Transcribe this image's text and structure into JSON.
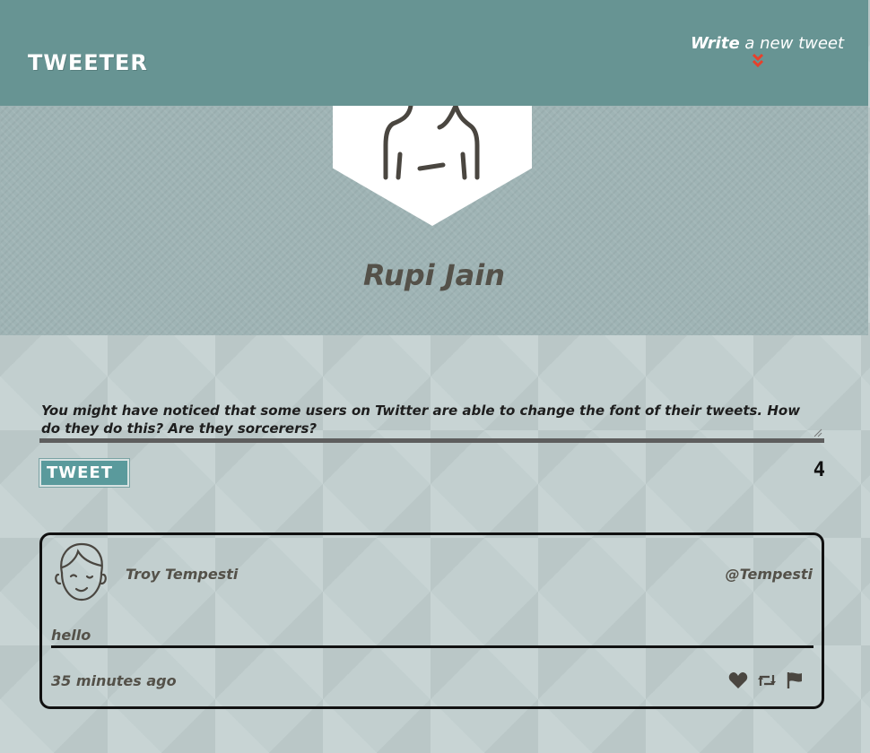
{
  "nav": {
    "brand": "TWEETER",
    "compose_strong": "Write",
    "compose_rest": " a new tweet",
    "chevron_icon": "double-chevron-down-icon",
    "chevron_color": "#e8402b"
  },
  "profile": {
    "name": "Rupi Jain",
    "avatar_icon": "person-back-icon"
  },
  "compose": {
    "text": "You might have noticed that some users on Twitter are able to change the font of their tweets. How do they do this? Are they sorcerers?",
    "button_label": "TWEET",
    "counter": "4"
  },
  "tweets": [
    {
      "author": "Troy Tempesti",
      "handle": "@Tempesti",
      "body": "hello",
      "time": "35 minutes ago",
      "avatar_icon": "boy-face-icon",
      "actions": [
        "heart-icon",
        "retweet-icon",
        "flag-icon"
      ]
    }
  ],
  "colors": {
    "nav_bg": "#679493",
    "header_bg": "#9fb4b5",
    "page_bg": "#c2cfcf",
    "button_bg": "#5a9a9c",
    "text_dark": "#545149"
  }
}
